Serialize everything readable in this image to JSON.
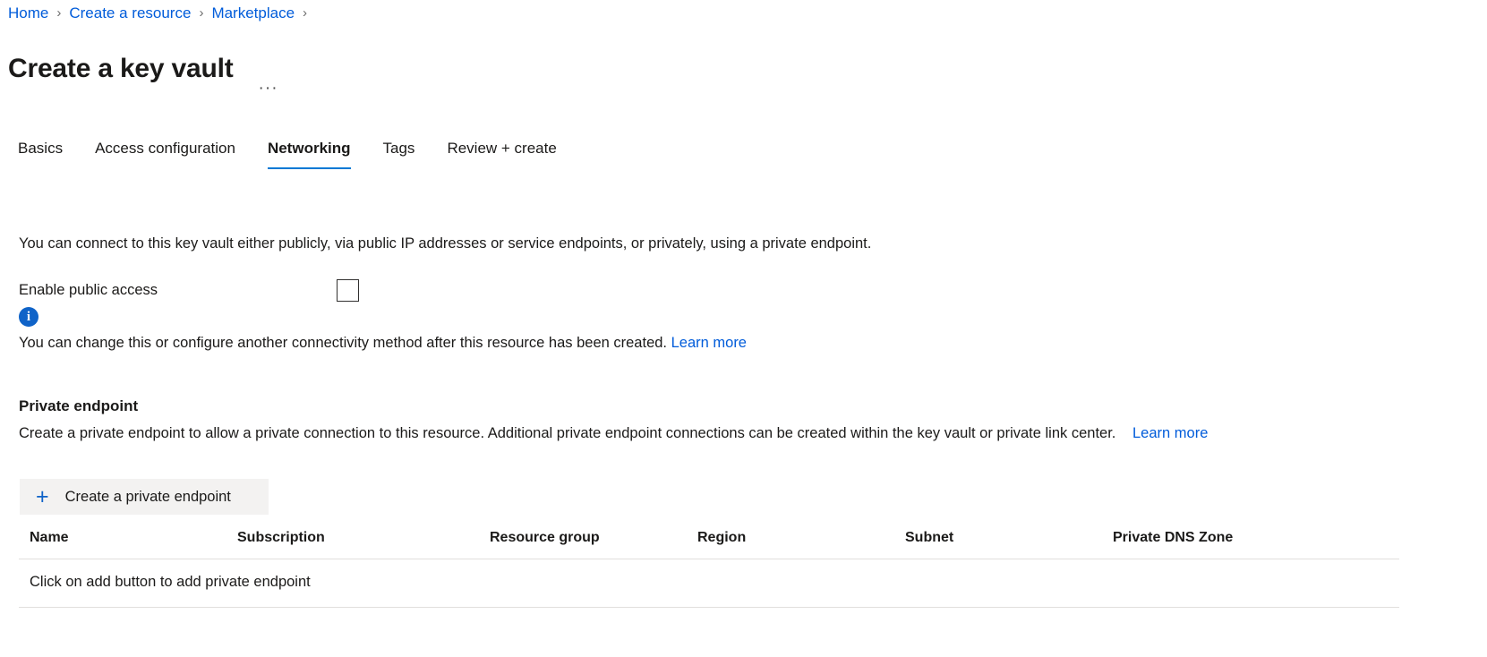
{
  "breadcrumb": {
    "items": [
      {
        "label": "Home"
      },
      {
        "label": "Create a resource"
      },
      {
        "label": "Marketplace"
      }
    ],
    "separator": "›"
  },
  "header": {
    "title": "Create a key vault",
    "more_label": "···"
  },
  "tabs": [
    {
      "label": "Basics",
      "active": false
    },
    {
      "label": "Access configuration",
      "active": false
    },
    {
      "label": "Networking",
      "active": true
    },
    {
      "label": "Tags",
      "active": false
    },
    {
      "label": "Review + create",
      "active": false
    }
  ],
  "networking": {
    "intro": "You can connect to this key vault either publicly, via public IP addresses or service endpoints, or privately, using a private endpoint.",
    "enable_public_access": {
      "label": "Enable public access",
      "checked": false
    },
    "info": {
      "icon": "info-icon",
      "text": "You can change this or configure another connectivity method after this resource has been created.",
      "link_label": "Learn more"
    }
  },
  "private_endpoint": {
    "section_title": "Private endpoint",
    "description": "Create a private endpoint to allow a private connection to this resource. Additional private endpoint connections can be created within the key vault or private link center.",
    "link_label": "Learn more",
    "add_button": {
      "icon": "plus-icon",
      "label": "Create a private endpoint"
    },
    "table": {
      "columns": [
        "Name",
        "Subscription",
        "Resource group",
        "Region",
        "Subnet",
        "Private DNS Zone"
      ],
      "empty_message": "Click on add button to add private endpoint",
      "rows": []
    }
  },
  "colors": {
    "link": "#015cda",
    "accent": "#0078d4",
    "info": "#0f63c8",
    "button_bg": "#f3f2f1",
    "border": "#e1dfdd"
  }
}
